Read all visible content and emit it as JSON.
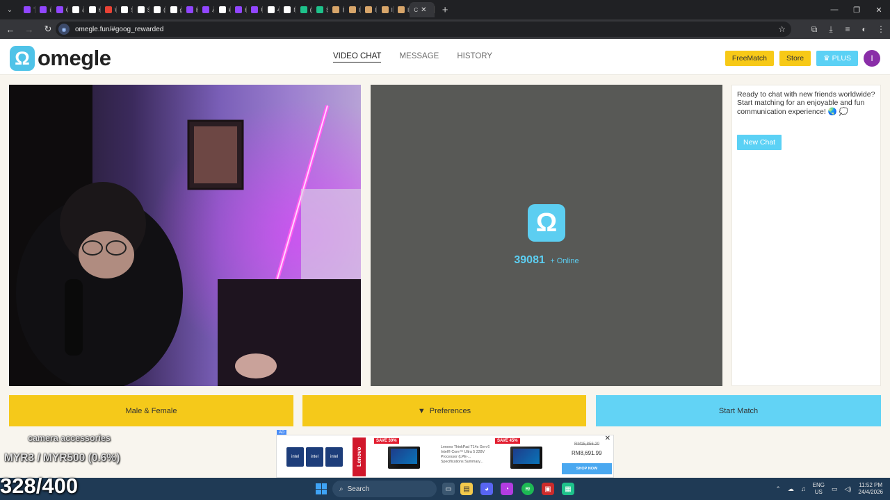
{
  "browser": {
    "tabs": [
      {
        "label": "Twit",
        "color": "#9146ff"
      },
      {
        "label": "iilxs",
        "color": "#9146ff"
      },
      {
        "label": "Ove",
        "color": "#9146ff"
      },
      {
        "label": "ave",
        "color": "#ffffff"
      },
      {
        "label": "Hist",
        "color": "#ffffff"
      },
      {
        "label": "Wh",
        "color": "#e94235"
      },
      {
        "label": "Stre",
        "color": "#ffffff"
      },
      {
        "label": "Stre",
        "color": "#ffffff"
      },
      {
        "label": "(99",
        "color": "#ffffff"
      },
      {
        "label": "goo",
        "color": "#ffffff"
      },
      {
        "label": "Hail",
        "color": "#9146ff"
      },
      {
        "label": "Acc",
        "color": "#9146ff"
      },
      {
        "label": "kot",
        "color": "#ffffff"
      },
      {
        "label": "Hail",
        "color": "#9146ff"
      },
      {
        "label": "Unt",
        "color": "#9146ff"
      },
      {
        "label": "45u",
        "color": "#ffffff"
      },
      {
        "label": "New",
        "color": "#ffffff"
      },
      {
        "label": "(74)",
        "color": "#1ec28b"
      },
      {
        "label": "Stre",
        "color": "#1ec28b"
      },
      {
        "label": "I",
        "color": "#d7a56a"
      },
      {
        "label": "I",
        "color": "#d7a56a"
      },
      {
        "label": "I",
        "color": "#d7a56a"
      },
      {
        "label": "I",
        "color": "#d7a56a"
      },
      {
        "label": "I",
        "color": "#d7a56a"
      }
    ],
    "active_tab": "C",
    "url": "omegle.fun/#goog_rewarded"
  },
  "site": {
    "brand": "omegle",
    "nav": [
      "VIDEO CHAT",
      "MESSAGE",
      "HISTORY"
    ],
    "freematch": "FreeMatch",
    "store": "Store",
    "plus": "PLUS",
    "avatar_initial": "I"
  },
  "stranger": {
    "online_count": "39081",
    "online_label": "+ Online"
  },
  "chat": {
    "welcome": "Ready to chat with new friends worldwide? Start matching for an enjoyable and fun communication experience! 🌏 💭",
    "new_chat": "New Chat"
  },
  "controls": {
    "gender": "Male & Female",
    "preferences": "Preferences",
    "start": "Start Match"
  },
  "ad": {
    "tag": "AD",
    "brand": "Lenovo",
    "save1": "SAVE 30%",
    "save2": "SAVE 45%",
    "desc": "Lenovo ThinkPad T14s Gen 6 Intel® Core™ Ultra 5 228V Processor (LPE-... Specifications Summary...",
    "price_old": "RM15,856.20",
    "price_new": "RM8,691.99",
    "cta": "SHOP NOW"
  },
  "overlay": {
    "line1": "camera accessories",
    "line2": "MYR3 / MYR500 (0.6%)",
    "line3": "328/400"
  },
  "taskbar": {
    "search": "Search",
    "lang1": "ENG",
    "lang2": "US",
    "time": "11:52 PM",
    "date": "24/4/2026"
  }
}
